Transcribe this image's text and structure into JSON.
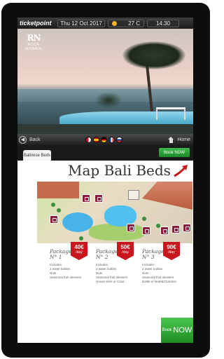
{
  "topbar": {
    "brand": "ticketpoint",
    "date": "Thu 12 Oct 2017",
    "temperature": "27 C",
    "time": "14:30"
  },
  "hero": {
    "logo_mark": "RN",
    "logo_name": "ROCA NIVARIA"
  },
  "nav": {
    "back_label": "Back",
    "home_label": "Home",
    "flags": [
      "#c8102e",
      "#f1bf00",
      "#000000",
      "#0055a4",
      "#d52b1e"
    ]
  },
  "tabs": {
    "active": "Balinese Beds",
    "book_now_label": "Book NOW"
  },
  "map": {
    "title": "Map Bali Beds"
  },
  "packages": [
    {
      "label": "Package",
      "number": "N° 1",
      "price": "40€",
      "per": "/day",
      "includes_title": "Includes:",
      "includes": [
        "2 water bottles",
        "Nuts",
        "Seasonal fruit skewers"
      ]
    },
    {
      "label": "Package",
      "number": "N° 2",
      "price": "50€",
      "per": "/day",
      "includes_title": "Includes:",
      "includes": [
        "2 water bottles",
        "Nuts",
        "Seasonal fruit skewers",
        "House wine or Cava"
      ]
    },
    {
      "label": "Package",
      "number": "N° 3",
      "price": "90€",
      "per": "/day",
      "includes_title": "Includes:",
      "includes": [
        "2 water bottles",
        "Nuts",
        "Seasonal fruit skewers",
        "Bottle of Moët&Chandon"
      ]
    }
  ],
  "book_now_bottom": {
    "small": "Book",
    "big": "NOW"
  },
  "colors": {
    "accent_red": "#c8161d",
    "accent_green": "#1c8a2a",
    "pin": "#8a1c3c"
  }
}
